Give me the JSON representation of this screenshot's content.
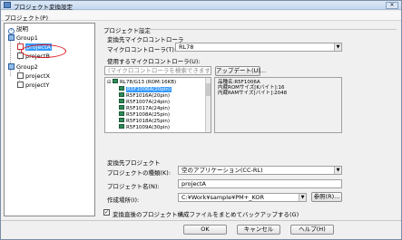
{
  "window": {
    "title": "プロジェクト変換設定",
    "close_label": "×"
  },
  "menu": {
    "project": "プロジェクト(P)"
  },
  "tree": {
    "nodes": [
      {
        "label": "説明",
        "icon": "help-icon"
      },
      {
        "label": "Group1",
        "icon": "group-icon"
      },
      {
        "label": "projectA",
        "icon": "project-icon"
      },
      {
        "label": "projectB",
        "icon": "project-icon"
      },
      {
        "label": "Group2",
        "icon": "group-icon"
      },
      {
        "label": "projectX",
        "icon": "project-icon"
      },
      {
        "label": "projectY",
        "icon": "project-icon"
      }
    ]
  },
  "settings": {
    "heading": "プロジェクト設定",
    "convert_mcu_heading": "変換先マイクロコントローラ",
    "mcu_label": "マイクロコントローラ(T):",
    "mcu_value": "RL78",
    "use_mcu_heading": "使用するマイクロコントローラ(U):",
    "search_placeholder": "(マイクロコントローラを検索できます)",
    "update_button": "アップデート(U)...",
    "device_group": "RL78/G13 (ROM:16KB)",
    "devices": [
      "R5F1006A(20pin)",
      "R5F1016A(20pin)",
      "R5F1007A(24pin)",
      "R5F1017A(24pin)",
      "R5F1008A(25pin)",
      "R5F1018A(25pin)",
      "R5F1009A(30pin)"
    ],
    "info_lines": [
      "品種名:R5F1006A",
      "内蔵ROMサイズ[Kバイト]:16",
      "内蔵RAMサイズ[バイト]:2048"
    ],
    "dest_project_heading": "変換先プロジェクト",
    "project_type_label": "プロジェクトの種類(K):",
    "project_type_value": "空のアプリケーション(CC-RL)",
    "project_name_label": "プロジェクト名(N):",
    "project_name_value": "projectA",
    "location_label": "作成場所(I):",
    "location_value": "C:¥Work¥sample¥PM+_KOR",
    "browse_button": "参照(R)...",
    "backup_checkbox": "変換直後のプロジェクト構成ファイルをまとめてバックアップする(G)"
  },
  "buttons": {
    "ok": "OK",
    "cancel": "キャンセル",
    "help": "ヘルプ(H)"
  }
}
